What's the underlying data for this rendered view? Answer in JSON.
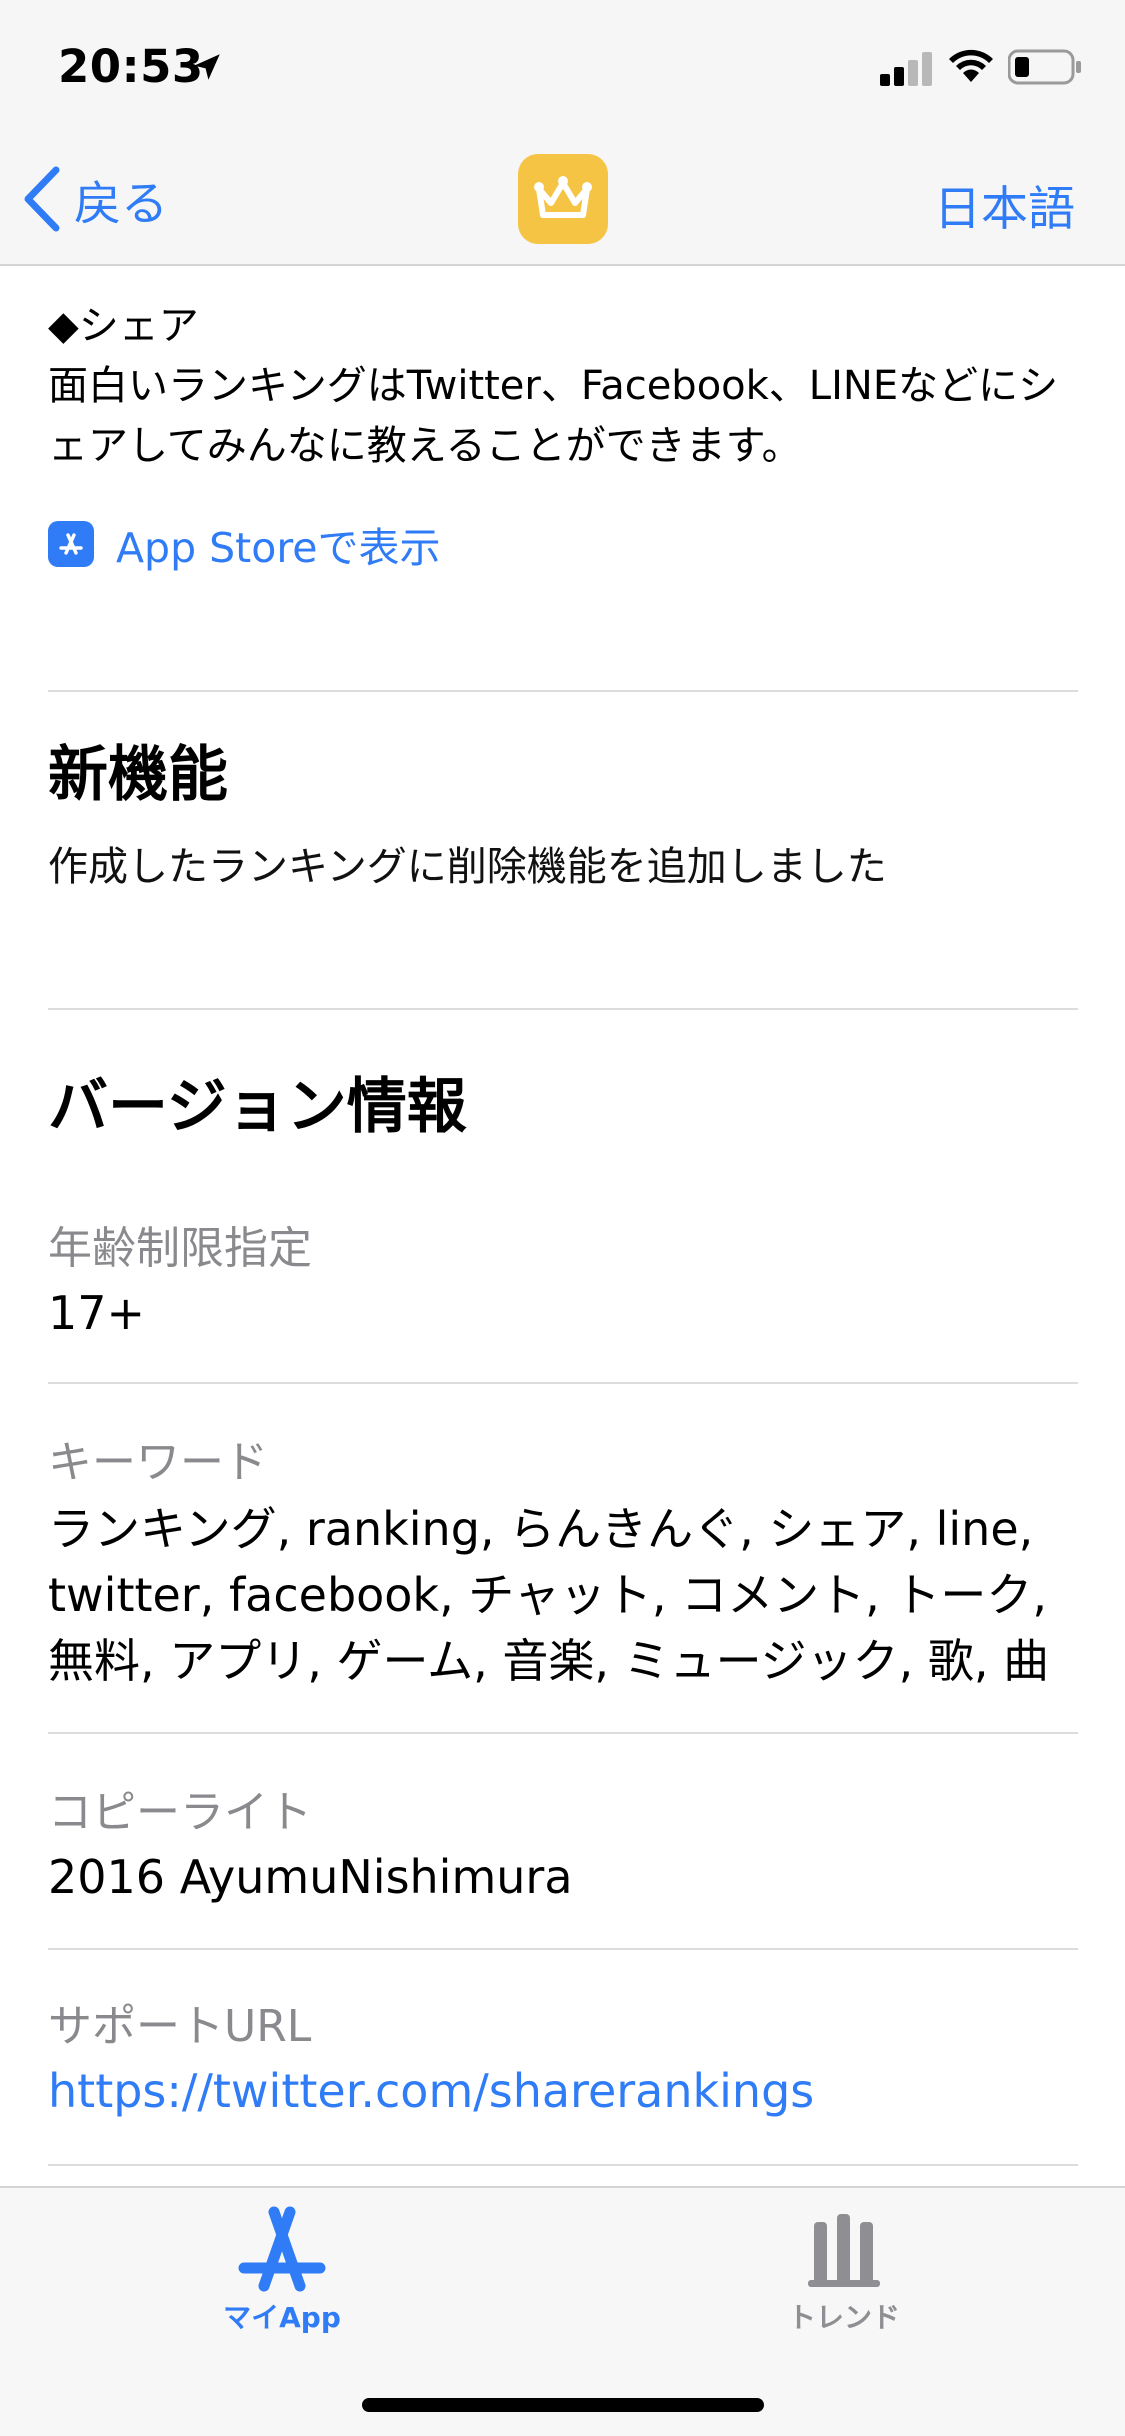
{
  "status_bar": {
    "time": "20:53"
  },
  "nav": {
    "back_label": "戻る",
    "language_label": "日本語"
  },
  "description": {
    "share_heading": "◆シェア",
    "share_body": "面白いランキングはTwitter、Facebook、LINEなどにシェアしてみんなに教えることができます。",
    "appstore_link": "App Storeで表示"
  },
  "whats_new": {
    "title": "新機能",
    "body": "作成したランキングに削除機能を追加しました"
  },
  "version_info": {
    "title": "バージョン情報",
    "age_rating_label": "年齢制限指定",
    "age_rating_value": "17+",
    "keywords_label": "キーワード",
    "keywords_value": "ランキング, ranking, らんきんぐ, シェア, line, twitter, facebook, チャット, コメント, トーク, 無料, アプリ, ゲーム, 音楽, ミュージック, 歌, 曲",
    "copyright_label": "コピーライト",
    "copyright_value": "2016 AyumuNishimura",
    "support_url_label": "サポートURL",
    "support_url_value": "https://twitter.com/sharerankings"
  },
  "tab_bar": {
    "my_app_label": "マイApp",
    "trend_label": "トレンド"
  },
  "colors": {
    "accent": "#2f7cf6",
    "app_icon_bg": "#f6c445",
    "secondary_text": "#8a8a8e"
  }
}
